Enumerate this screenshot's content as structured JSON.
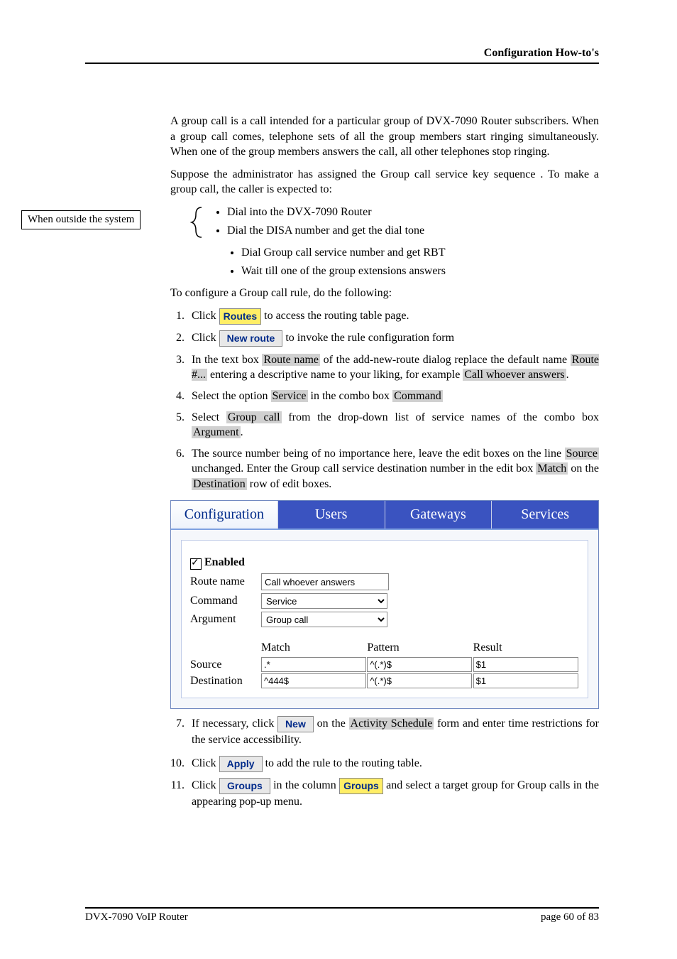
{
  "header": {
    "section": "Configuration How-to's"
  },
  "intro": {
    "p1": "A group call is a call intended for a particular group of DVX-7090 Router subscribers. When a group call comes, telephone sets of all the group members start ringing simultaneously. When one of the group members answers the call, all other telephones stop ringing.",
    "p2a": "Suppose the administrator has assigned the Group call service key sequence ",
    "p2b": ". To make a group call, the caller is expected to:"
  },
  "side_label": "When outside the system",
  "bullets": {
    "b1": "Dial into the DVX-7090 Router",
    "b2": "Dial the DISA number and get the dial tone",
    "b3a": "Dial Group call service number ",
    "b3b": " and get RBT",
    "b4": "Wait till one of the group extensions answers"
  },
  "lead2": "To configure a Group call rule, do the following:",
  "steps": {
    "s1a": "Click ",
    "s1_btn": "Routes",
    "s1b": " to access the routing table page.",
    "s2a": "Click ",
    "s2_btn": "New route",
    "s2b": " to invoke the rule configuration form",
    "s3a": "In the text box ",
    "s3_hl1": "Route name",
    "s3b": " of the add-new-route dialog replace the default name ",
    "s3_hl2": "Route #...",
    "s3c": " entering a descriptive name to your liking, for example ",
    "s3_hl3": "Call whoever answers",
    "s3d": ".",
    "s4a": "Select the option ",
    "s4_hl1": "Service",
    "s4b": " in the combo box ",
    "s4_hl2": "Command",
    "s5a": "Select ",
    "s5_hl1": "Group call",
    "s5b": " from the drop-down list of service names of the combo box ",
    "s5_hl2": "Argument",
    "s5c": ".",
    "s6a": "The source number being of no importance here, leave the edit boxes on the line ",
    "s6_hl1": "Source",
    "s6b": " unchanged. Enter the Group call service destination number ",
    "s6c": " in the edit box ",
    "s6_hl2": "Match",
    "s6d": " on the ",
    "s6_hl3": "Destination",
    "s6e": " row of edit boxes.",
    "s7a": "If necessary, click ",
    "s7_btn": "New",
    "s7b": " on the ",
    "s7_hl1": "Activity Schedule",
    "s7c": " form and enter time restrictions for the service accessibility.",
    "s10a": "Click ",
    "s10_btn": "Apply",
    "s10b": " to add the rule to the routing table.",
    "s11a": "Click ",
    "s11_btn": "Groups",
    "s11b": " in the column ",
    "s11_btn2": "Groups",
    "s11c": " and select a target group for Group calls in the appearing pop-up menu."
  },
  "panel": {
    "tabs": {
      "t1": "Configuration",
      "t2": "Users",
      "t3": "Gateways",
      "t4": "Services"
    },
    "enabled": "Enabled",
    "labels": {
      "route_name": "Route name",
      "command": "Command",
      "argument": "Argument",
      "match": "Match",
      "pattern": "Pattern",
      "result": "Result",
      "source": "Source",
      "destination": "Destination"
    },
    "values": {
      "route_name": "Call whoever answers",
      "command": "Service",
      "argument": "Group call",
      "src_match": ".*",
      "src_pattern": "^(.*)$",
      "src_result": "$1",
      "dst_match": "^444$",
      "dst_pattern": "^(.*)$",
      "dst_result": "$1"
    }
  },
  "footer": {
    "left": "DVX-7090 VoIP Router",
    "right": "page 60 of 83"
  }
}
